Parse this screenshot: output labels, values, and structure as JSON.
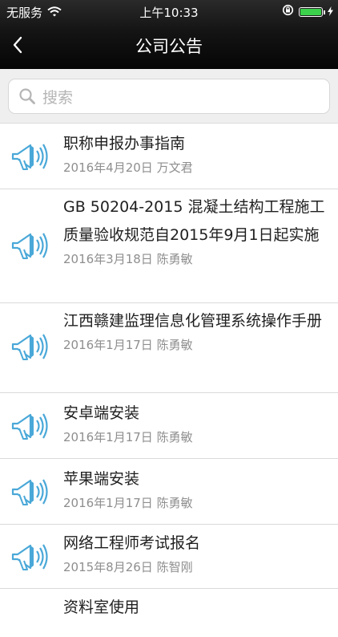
{
  "status_bar": {
    "carrier": "无服务",
    "time": "上午10:33",
    "battery_level": 1.0
  },
  "nav": {
    "title": "公司公告",
    "back_icon": "chevron-left-icon"
  },
  "search": {
    "placeholder": "搜索",
    "icon": "search-icon"
  },
  "notices": [
    {
      "title": "职称申报办事指南",
      "date": "2016年4月20日",
      "author": "万文君"
    },
    {
      "title": "GB 50204-2015 混凝土结构工程施工质量验收规范自2015年9月1日起实施",
      "date": "2016年3月18日",
      "author": "陈勇敏"
    },
    {
      "title": "江西赣建监理信息化管理系统操作手册",
      "date": "2016年1月17日",
      "author": "陈勇敏"
    },
    {
      "title": "安卓端安装",
      "date": "2016年1月17日",
      "author": "陈勇敏"
    },
    {
      "title": "苹果端安装",
      "date": "2016年1月17日",
      "author": "陈勇敏"
    },
    {
      "title": "网络工程师考试报名",
      "date": "2015年8月26日",
      "author": "陈智刚"
    },
    {
      "title": "资料室使用",
      "date": "",
      "author": ""
    }
  ],
  "colors": {
    "header_bg": "#111111",
    "icon_blue": "#4aa8d8",
    "meta_text": "#8e8e8e",
    "battery": "#3bd14b"
  }
}
